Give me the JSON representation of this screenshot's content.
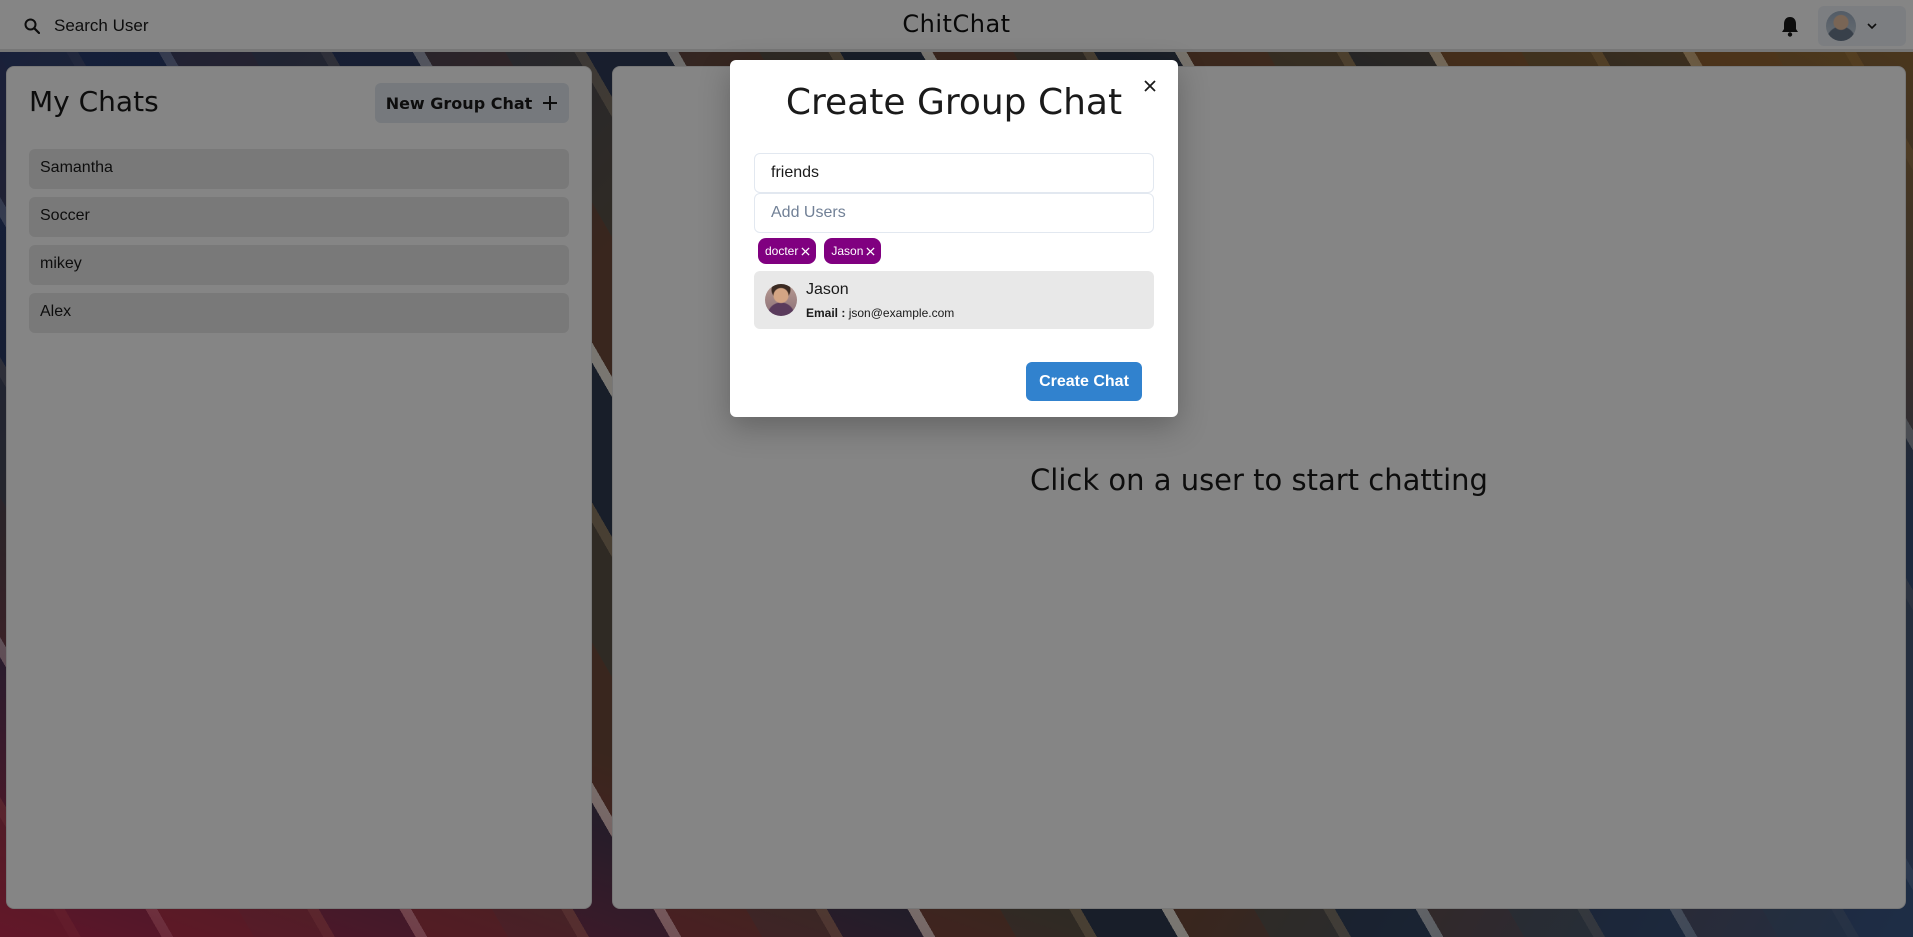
{
  "header": {
    "search_label": "Search User",
    "app_title": "ChitChat"
  },
  "sidebar": {
    "title": "My Chats",
    "new_group_label": "New Group Chat",
    "chats": [
      {
        "name": "Samantha"
      },
      {
        "name": "Soccer"
      },
      {
        "name": "mikey"
      },
      {
        "name": "Alex"
      }
    ]
  },
  "chat_area": {
    "placeholder": "Click on a user to start chatting"
  },
  "modal": {
    "title": "Create Group Chat",
    "chat_name_value": "friends",
    "add_users_placeholder": "Add Users",
    "selected_users": [
      {
        "name": "docter"
      },
      {
        "name": "Jason"
      }
    ],
    "search_result": {
      "name": "Jason",
      "email_label": "Email :",
      "email": "json@example.com"
    },
    "create_label": "Create Chat"
  },
  "colors": {
    "tag_bg": "#800080",
    "primary_button": "#3182ce"
  },
  "icons": [
    "search-icon",
    "bell-icon",
    "chevron-down-icon",
    "plus-icon",
    "close-icon"
  ]
}
